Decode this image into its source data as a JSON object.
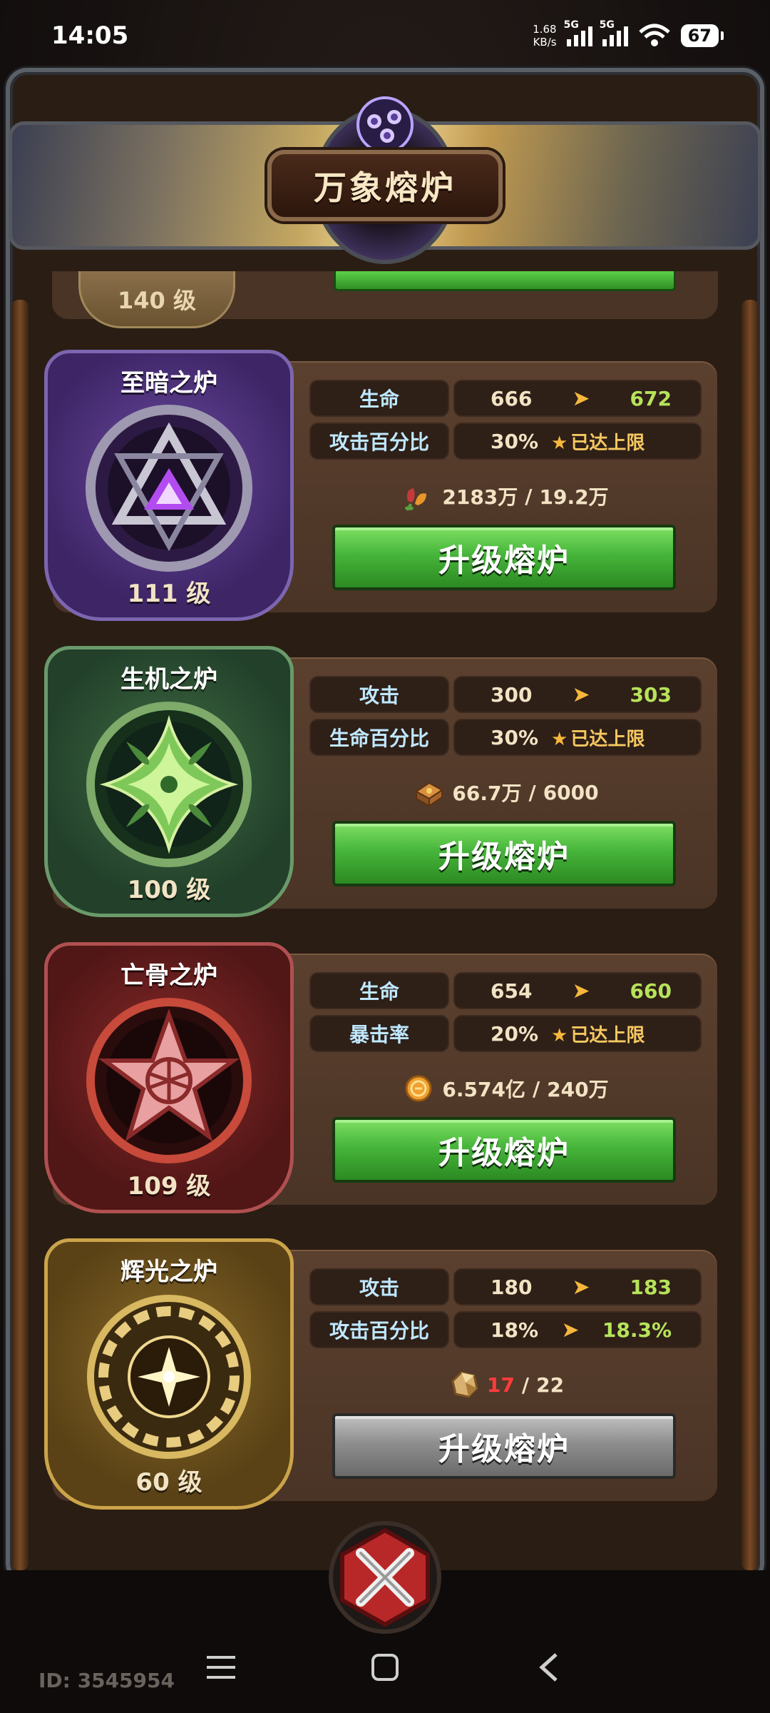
{
  "status_bar": {
    "time": "14:05",
    "net_speed_value": "1.68",
    "net_speed_unit": "KB/s",
    "signal_label_1": "5G",
    "signal_label_2": "5G",
    "battery": "67"
  },
  "header": {
    "title": "万象熔炉",
    "icon": "swirl-icon"
  },
  "partial_card": {
    "level": "140 级"
  },
  "forges": [
    {
      "name": "至暗之炉",
      "level": "111 级",
      "theme": "purple",
      "stats": [
        {
          "label": "生命",
          "current": "666",
          "next": "672"
        },
        {
          "label": "攻击百分比",
          "current": "30%",
          "maxed": "已达上限"
        }
      ],
      "cost": {
        "icon": "flower-icon",
        "current": "2183万",
        "separator": "/",
        "required": "19.2万"
      },
      "button": "升级熔炉"
    },
    {
      "name": "生机之炉",
      "level": "100 级",
      "theme": "green",
      "stats": [
        {
          "label": "攻击",
          "current": "300",
          "next": "303"
        },
        {
          "label": "生命百分比",
          "current": "30%",
          "maxed": "已达上限"
        }
      ],
      "cost": {
        "icon": "chest-icon",
        "current": "66.7万",
        "separator": "/",
        "required": "6000"
      },
      "button": "升级熔炉"
    },
    {
      "name": "亡骨之炉",
      "level": "109 级",
      "theme": "red",
      "stats": [
        {
          "label": "生命",
          "current": "654",
          "next": "660"
        },
        {
          "label": "暴击率",
          "current": "20%",
          "maxed": "已达上限"
        }
      ],
      "cost": {
        "icon": "coin-icon",
        "current": "6.574亿",
        "separator": "/",
        "required": "240万"
      },
      "button": "升级熔炉"
    },
    {
      "name": "辉光之炉",
      "level": "60 级",
      "theme": "gold",
      "stats": [
        {
          "label": "攻击",
          "current": "180",
          "next": "183"
        },
        {
          "label": "攻击百分比",
          "current": "18%",
          "next": "18.3%"
        }
      ],
      "cost": {
        "icon": "ore-icon",
        "current": "17",
        "separator": "/",
        "required": "22"
      },
      "button": "升级熔炉"
    }
  ],
  "footer": {
    "id_text": "ID: 3545954"
  },
  "colors": {
    "stat_label": "#bfe8ff",
    "next_value": "#b6e35a",
    "arrow": "#f6b73c",
    "insufficient": "#ff3c3c",
    "button_green": "#46b53a",
    "button_gray": "#8e8e8e"
  }
}
